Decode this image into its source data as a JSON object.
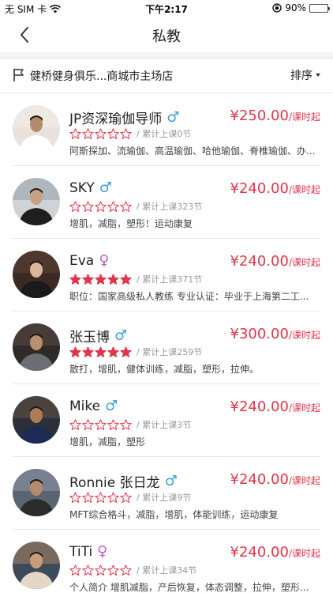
{
  "status_bar": {
    "carrier": "无 SIM 卡",
    "time": "下午2:17",
    "battery": "90%",
    "battery_level": 0.9,
    "icons": [
      "wifi-icon",
      "rotation-lock-icon",
      "battery-icon"
    ]
  },
  "nav": {
    "title": "私教",
    "back_icon": "chevron-left-icon"
  },
  "store": {
    "name": "健桥健身俱乐...商城市主场店",
    "sort_label": "排序",
    "flag_icon": "flag-icon"
  },
  "colors": {
    "price": "#e0354a",
    "star": "#e0354a",
    "male": "#3a9fd9",
    "female": "#c25fc9"
  },
  "coaches": [
    {
      "name": "JP资深瑜伽导师",
      "gender": "♂",
      "gender_type": "male",
      "price": "¥250.00",
      "unit": "/课时起",
      "rating": 0,
      "lessons": "/ 累计上课0节",
      "tags": "阿斯探加、流瑜伽、高温瑜伽、哈他瑜伽、脊椎瑜伽、办...",
      "avatar": "coach-photo-yoga"
    },
    {
      "name": "SKY",
      "gender": "♂",
      "gender_type": "male",
      "price": "¥240.00",
      "unit": "/课时起",
      "rating": 0,
      "lessons": "/ 累计上课323节",
      "tags": "增肌，减脂，塑形！运动康复",
      "avatar": "coach-photo"
    },
    {
      "name": "Eva",
      "gender": "♀",
      "gender_type": "female",
      "price": "¥240.00",
      "unit": "/课时起",
      "rating": 5,
      "lessons": "/ 累计上课371节",
      "tags": "职位：国家高级私人教练 专业认证：毕业于上海第二工...",
      "avatar": "coach-photo"
    },
    {
      "name": "张玉博",
      "gender": "♂",
      "gender_type": "male",
      "price": "¥300.00",
      "unit": "/课时起",
      "rating": 5,
      "lessons": "/ 累计上课259节",
      "tags": "散打，增肌，健体训练，减脂，塑形，拉伸。",
      "avatar": "coach-photo"
    },
    {
      "name": "Mike",
      "gender": "♂",
      "gender_type": "male",
      "price": "¥240.00",
      "unit": "/课时起",
      "rating": 0,
      "lessons": "/ 累计上课3节",
      "tags": "增肌，减脂，塑形",
      "avatar": "coach-photo"
    },
    {
      "name": "Ronnie 张日龙",
      "gender": "♂",
      "gender_type": "male",
      "price": "¥240.00",
      "unit": "/课时起",
      "rating": 0,
      "lessons": "/ 累计上课9节",
      "tags": "MFT综合格斗，减脂，增肌，体能训练，运动康复",
      "avatar": "coach-photo"
    },
    {
      "name": "TiTi",
      "gender": "♀",
      "gender_type": "female",
      "price": "¥240.00",
      "unit": "/课时起",
      "rating": 0,
      "lessons": "/ 累计上课34节",
      "tags": "个人简介 增肌减脂，产后恢复，体态调整，拉伸，塑形...",
      "avatar": "coach-photo"
    }
  ]
}
